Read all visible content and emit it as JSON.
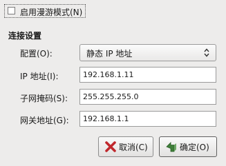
{
  "roaming": {
    "label": "启用漫游模式(N)",
    "checked": false
  },
  "connection": {
    "title": "连接设置",
    "config_label": "配置(O):",
    "config_value": "静态 IP 地址",
    "ip_label": "IP 地址(I):",
    "ip_value": "192.168.1.11",
    "mask_label": "子网掩码(S):",
    "mask_value": "255.255.255.0",
    "gateway_label": "网关地址(G):",
    "gateway_value": "192.168.1.1"
  },
  "buttons": {
    "cancel_label": "取消(C)",
    "ok_label": "确定(O)"
  },
  "colors": {
    "cancel_icon": "#c0282d",
    "ok_icon": "#3f7f3a"
  }
}
